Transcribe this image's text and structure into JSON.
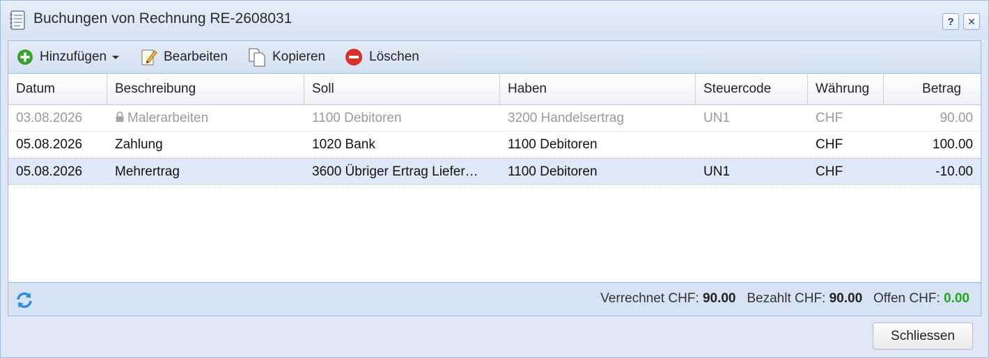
{
  "window": {
    "title": "Buchungen von Rechnung RE-2608031",
    "help_label": "?",
    "close_label": "✕"
  },
  "toolbar": {
    "add_label": "Hinzufügen",
    "edit_label": "Bearbeiten",
    "copy_label": "Kopieren",
    "delete_label": "Löschen"
  },
  "table": {
    "columns": [
      "Datum",
      "Beschreibung",
      "Soll",
      "Haben",
      "Steuercode",
      "Währung",
      "Betrag"
    ],
    "rows": [
      {
        "datum": "03.08.2026",
        "beschreibung": "Malerarbeiten",
        "soll": "1100 Debitoren",
        "haben": "3200 Handelsertrag",
        "steuercode": "UN1",
        "waehrung": "CHF",
        "betrag": "90.00"
      },
      {
        "datum": "05.08.2026",
        "beschreibung": "Zahlung",
        "soll": "1020 Bank",
        "haben": "1100 Debitoren",
        "steuercode": "",
        "waehrung": "CHF",
        "betrag": "100.00"
      },
      {
        "datum": "05.08.2026",
        "beschreibung": "Mehrertrag",
        "soll": "3600 Übriger Ertrag Liefer…",
        "haben": "1100 Debitoren",
        "steuercode": "UN1",
        "waehrung": "CHF",
        "betrag": "-10.00"
      }
    ]
  },
  "summary": {
    "verrechnet_label": "Verrechnet CHF:",
    "verrechnet_value": "90.00",
    "bezahlt_label": "Bezahlt CHF:",
    "bezahlt_value": "90.00",
    "offen_label": "Offen CHF:",
    "offen_value": "0.00"
  },
  "footer": {
    "close_button_label": "Schliessen"
  },
  "colors": {
    "accent_border": "#99bbe8",
    "selected_row": "#dfe8f6",
    "offen_value": "#22a822",
    "add_icon": "#3ba32d",
    "delete_icon": "#d9302c",
    "refresh_icon": "#2a8be0"
  }
}
